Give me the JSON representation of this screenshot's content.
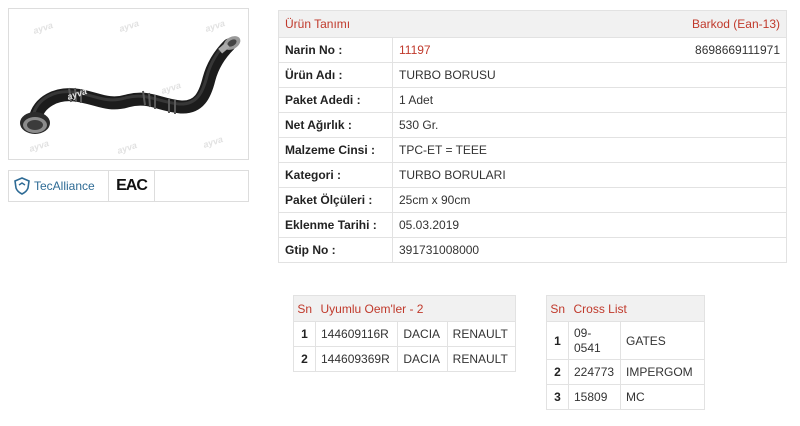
{
  "product_image": {
    "watermark": "ayva",
    "alt": "TURBO BORUSU"
  },
  "logos": {
    "tecalliance": "TecAlliance",
    "eac": "EAC"
  },
  "info": {
    "header_left": "Ürün Tanımı",
    "header_right": "Barkod (Ean-13)",
    "rows": [
      {
        "label": "Narin No :",
        "value": "11197",
        "extra": "8698669111971"
      },
      {
        "label": "Ürün Adı :",
        "value": "TURBO BORUSU"
      },
      {
        "label": "Paket Adedi :",
        "value": "1 Adet"
      },
      {
        "label": "Net Ağırlık :",
        "value": "530 Gr."
      },
      {
        "label": "Malzeme Cinsi :",
        "value": "TPC-ET = TEEE"
      },
      {
        "label": "Kategori :",
        "value": "TURBO BORULARI"
      },
      {
        "label": "Paket Ölçüleri :",
        "value": "25cm x 90cm"
      },
      {
        "label": "Eklenme Tarihi :",
        "value": "05.03.2019"
      },
      {
        "label": "Gtip No :",
        "value": "391731008000"
      }
    ]
  },
  "oem": {
    "sn_header": "Sn",
    "title": "Uyumlu Oem'ler - 2",
    "rows": [
      {
        "sn": "1",
        "code": "144609116R",
        "brand": "DACIA",
        "make": "RENAULT"
      },
      {
        "sn": "2",
        "code": "144609369R",
        "brand": "DACIA",
        "make": "RENAULT"
      }
    ]
  },
  "cross": {
    "sn_header": "Sn",
    "title": "Cross List",
    "rows": [
      {
        "sn": "1",
        "code": "09-0541",
        "code_line1": "09-",
        "code_line2": "0541",
        "brand": "GATES"
      },
      {
        "sn": "2",
        "code": "224773",
        "brand": "IMPERGOM"
      },
      {
        "sn": "3",
        "code": "15809",
        "brand": "MC"
      }
    ]
  },
  "colors": {
    "accent_red": "#c0392b",
    "header_bg": "#f1f1f1",
    "border": "#e2e2e2",
    "tecalliance_blue": "#2e6b95"
  }
}
